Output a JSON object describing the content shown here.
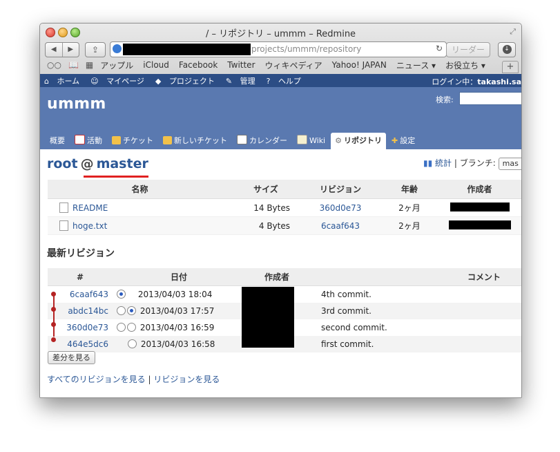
{
  "window": {
    "title": "/ – リポジトリ – ummm – Redmine",
    "url_visible": "projects/ummm/repository",
    "reader_label": "リーダー"
  },
  "bookmarks": [
    "アップル",
    "iCloud",
    "Facebook",
    "Twitter",
    "ウィキペディア",
    "Yahoo! JAPAN",
    "ニュース ▾",
    "お役立ち ▾"
  ],
  "top_menu": {
    "items": [
      "ホーム",
      "マイページ",
      "プロジェクト",
      "管理",
      "ヘルプ"
    ],
    "logged_in_label": "ログイン中：",
    "user": "takashi.sa"
  },
  "header": {
    "project": "ummm",
    "search_label": "検索:"
  },
  "tabs": [
    {
      "label": "概要",
      "icon": "none"
    },
    {
      "label": "活動",
      "icon": "activity-icon"
    },
    {
      "label": "チケット",
      "icon": "ticket-icon"
    },
    {
      "label": "新しいチケット",
      "icon": "new-ticket-icon"
    },
    {
      "label": "カレンダー",
      "icon": "calendar-icon"
    },
    {
      "label": "Wiki",
      "icon": "wiki-icon"
    },
    {
      "label": "リポジトリ",
      "icon": "repository-icon",
      "selected": true
    },
    {
      "label": "設定",
      "icon": "settings-icon"
    }
  ],
  "breadcrumb": {
    "root": "root",
    "at": "@",
    "branch": "master"
  },
  "stats": {
    "label": "統計",
    "sep": "|",
    "branch_label": "ブランチ:",
    "branch_value": "mas"
  },
  "files": {
    "headers": [
      "名称",
      "サイズ",
      "リビジョン",
      "年齢",
      "作成者"
    ],
    "rows": [
      {
        "name": "README",
        "size": "14 Bytes",
        "revision": "360d0e73",
        "age": "2ヶ月"
      },
      {
        "name": "hoge.txt",
        "size": "4 Bytes",
        "revision": "6caaf643",
        "age": "2ヶ月"
      }
    ]
  },
  "latest_revisions": {
    "title": "最新リビジョン",
    "headers": [
      "#",
      "日付",
      "作成者",
      "コメント"
    ],
    "rows": [
      {
        "rev": "6caaf643",
        "date": "2013/04/03 18:04",
        "comment": "4th commit."
      },
      {
        "rev": "abdc14bc",
        "date": "2013/04/03 17:57",
        "comment": "3rd commit."
      },
      {
        "rev": "360d0e73",
        "date": "2013/04/03 16:59",
        "comment": "second commit."
      },
      {
        "rev": "464e5dc6",
        "date": "2013/04/03 16:58",
        "comment": "first commit."
      }
    ],
    "diff_button": "差分を見る"
  },
  "footer": {
    "all_revisions": "すべてのリビジョンを見る",
    "sep": "|",
    "view_revisions": "リビジョンを見る"
  },
  "colors": {
    "header_bg": "#5a79b0",
    "top_menu_bg": "#2c4d85",
    "link": "#2b5796",
    "graph": "#b52323",
    "underline": "#e02020"
  }
}
